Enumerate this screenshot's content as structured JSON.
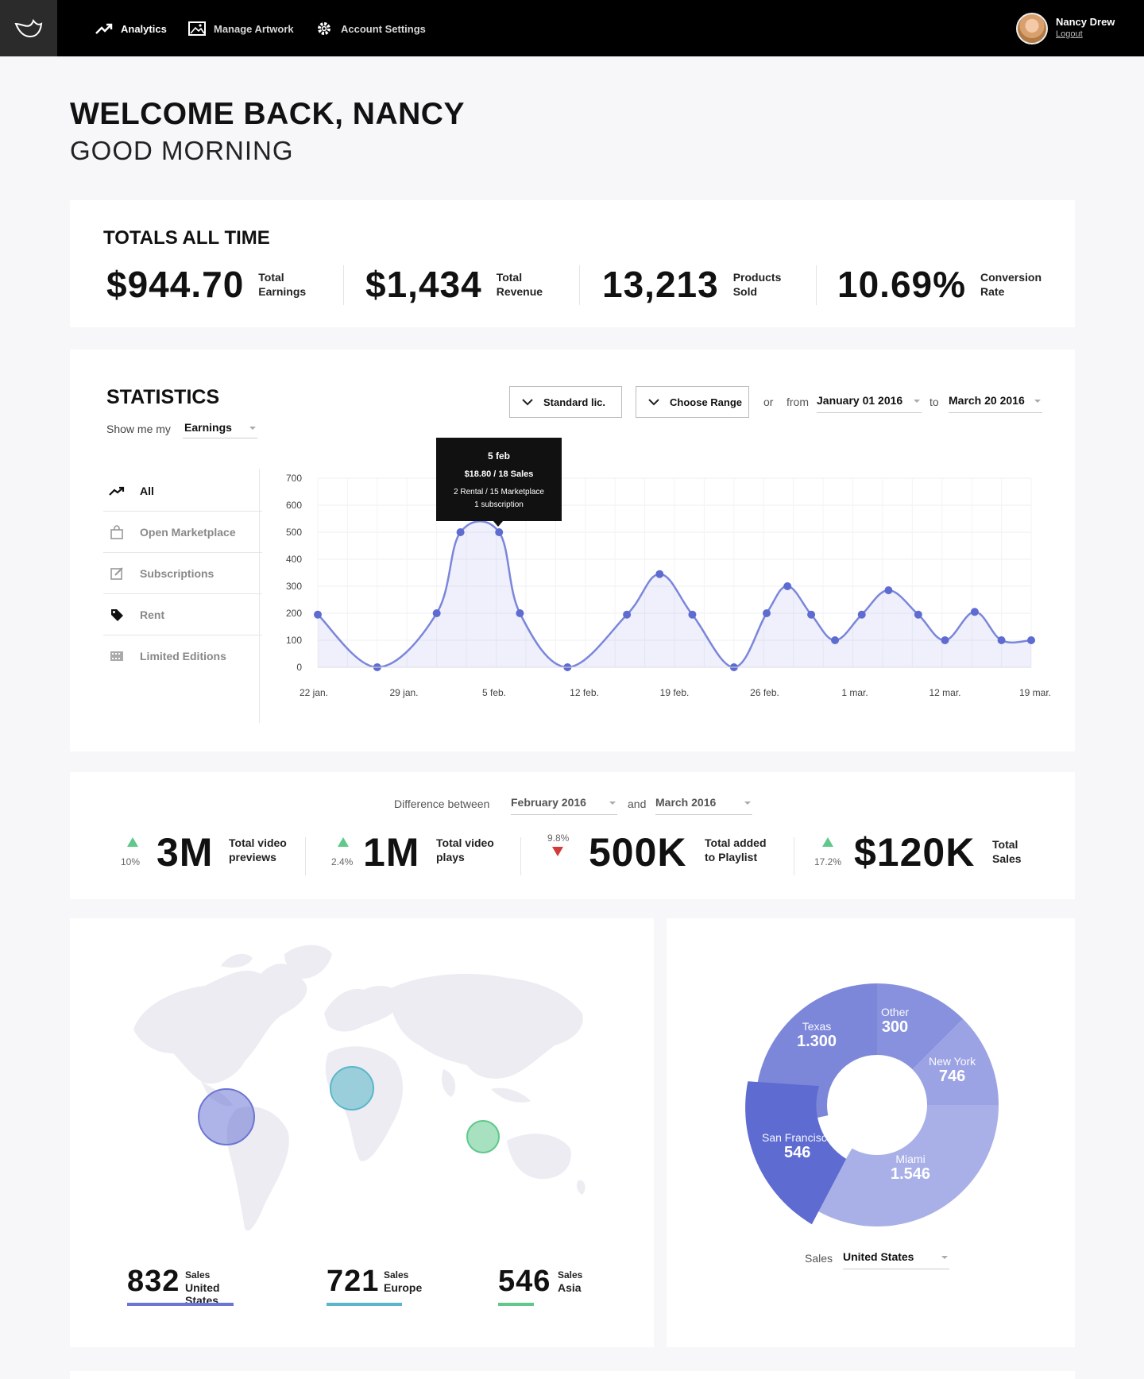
{
  "nav": {
    "items": [
      {
        "label": "Analytics",
        "icon": "trending-up-icon"
      },
      {
        "label": "Manage Artwork",
        "icon": "image-icon"
      },
      {
        "label": "Account Settings",
        "icon": "gear-icon"
      }
    ],
    "user": {
      "name": "Nancy Drew",
      "logout": "Logout"
    }
  },
  "greeting": {
    "title": "WELCOME BACK, NANCY",
    "subtitle": "GOOD MORNING"
  },
  "totals": {
    "title": "TOTALS ALL TIME",
    "items": [
      {
        "value": "$944.70",
        "label": "Total\nEarnings"
      },
      {
        "value": "$1,434",
        "label": "Total\nRevenue"
      },
      {
        "value": "13,213",
        "label": "Products\nSold"
      },
      {
        "value": "10.69%",
        "label": "Conversion\nRate"
      }
    ]
  },
  "statistics": {
    "title": "STATISTICS",
    "show_me_label": "Show me my",
    "show_me_value": "Earnings",
    "license_button": "Standard lic.",
    "range_button": "Choose Range",
    "or_label": "or",
    "from_label": "from",
    "from_date": "January 01 2016",
    "to_label": "to",
    "to_date": "March 20 2016",
    "filters": [
      {
        "label": "All",
        "icon": "trending-up-icon",
        "active": true
      },
      {
        "label": "Open Marketplace",
        "icon": "shopping-bag-icon",
        "active": false
      },
      {
        "label": "Subscriptions",
        "icon": "edit-icon",
        "active": false
      },
      {
        "label": "Rent",
        "icon": "tag-icon",
        "active": false
      },
      {
        "label": "Limited Editions",
        "icon": "film-icon",
        "active": false
      }
    ],
    "tooltip": {
      "date": "5 feb",
      "sales": "$18.80 / 18 Sales",
      "detail1": "2 Rental / 15 Marketplace",
      "detail2": "1 subscription"
    }
  },
  "chart_data": {
    "type": "area",
    "x_tick_labels": [
      "22 jan.",
      "29 jan.",
      "5 feb.",
      "12 feb.",
      "19 feb.",
      "26 feb.",
      "1 mar.",
      "12 mar.",
      "19 mar."
    ],
    "y_ticks": [
      0,
      100,
      200,
      300,
      400,
      500,
      600,
      700
    ],
    "ylim": [
      0,
      700
    ],
    "x_index_range": [
      0,
      24
    ],
    "points": [
      {
        "x": 0,
        "y": 195
      },
      {
        "x": 2,
        "y": 0
      },
      {
        "x": 4,
        "y": 200
      },
      {
        "x": 4.8,
        "y": 500
      },
      {
        "x": 6.1,
        "y": 500
      },
      {
        "x": 6.8,
        "y": 200
      },
      {
        "x": 8.4,
        "y": 0
      },
      {
        "x": 10.4,
        "y": 195
      },
      {
        "x": 11.5,
        "y": 345
      },
      {
        "x": 12.6,
        "y": 195
      },
      {
        "x": 14,
        "y": 0
      },
      {
        "x": 15.1,
        "y": 200
      },
      {
        "x": 15.8,
        "y": 300
      },
      {
        "x": 16.6,
        "y": 195
      },
      {
        "x": 17.4,
        "y": 100
      },
      {
        "x": 18.3,
        "y": 195
      },
      {
        "x": 19.2,
        "y": 285
      },
      {
        "x": 20.2,
        "y": 195
      },
      {
        "x": 21.1,
        "y": 100
      },
      {
        "x": 22.1,
        "y": 205
      },
      {
        "x": 23,
        "y": 100
      },
      {
        "x": 24,
        "y": 100
      }
    ],
    "grid": true,
    "color": "#7b86db"
  },
  "difference": {
    "label": "Difference between",
    "month1": "February 2016",
    "and_label": "and",
    "month2": "March 2016",
    "items": [
      {
        "pct": "10%",
        "direction": "up",
        "value": "3M",
        "label": "Total video\npreviews"
      },
      {
        "pct": "2.4%",
        "direction": "up",
        "value": "1M",
        "label": "Total video\nplays"
      },
      {
        "pct": "9.8%",
        "direction": "down",
        "value": "500K",
        "label": "Total added\nto Playlist"
      },
      {
        "pct": "17.2%",
        "direction": "up",
        "value": "$120K",
        "label": "Total\nSales"
      }
    ]
  },
  "regions": [
    {
      "value": "832",
      "label1": "Sales",
      "label2": "United States",
      "color": "#6b76d4"
    },
    {
      "value": "721",
      "label1": "Sales",
      "label2": "Europe",
      "color": "#5ab6c9"
    },
    {
      "value": "546",
      "label1": "Sales",
      "label2": "Asia",
      "color": "#5fc88a"
    }
  ],
  "city_sales": {
    "sales_label": "Sales",
    "country": "United States",
    "slices": [
      {
        "name": "Other",
        "value": "300",
        "color": "#8891de"
      },
      {
        "name": "New York",
        "value": "746",
        "color": "#9ba3e4"
      },
      {
        "name": "Miami",
        "value": "1.546",
        "color": "#a9b0e8"
      },
      {
        "name": "San Francisco",
        "value": "546",
        "color": "#5e6bd0"
      },
      {
        "name": "Texas",
        "value": "1.300",
        "color": "#7d87da"
      }
    ]
  }
}
